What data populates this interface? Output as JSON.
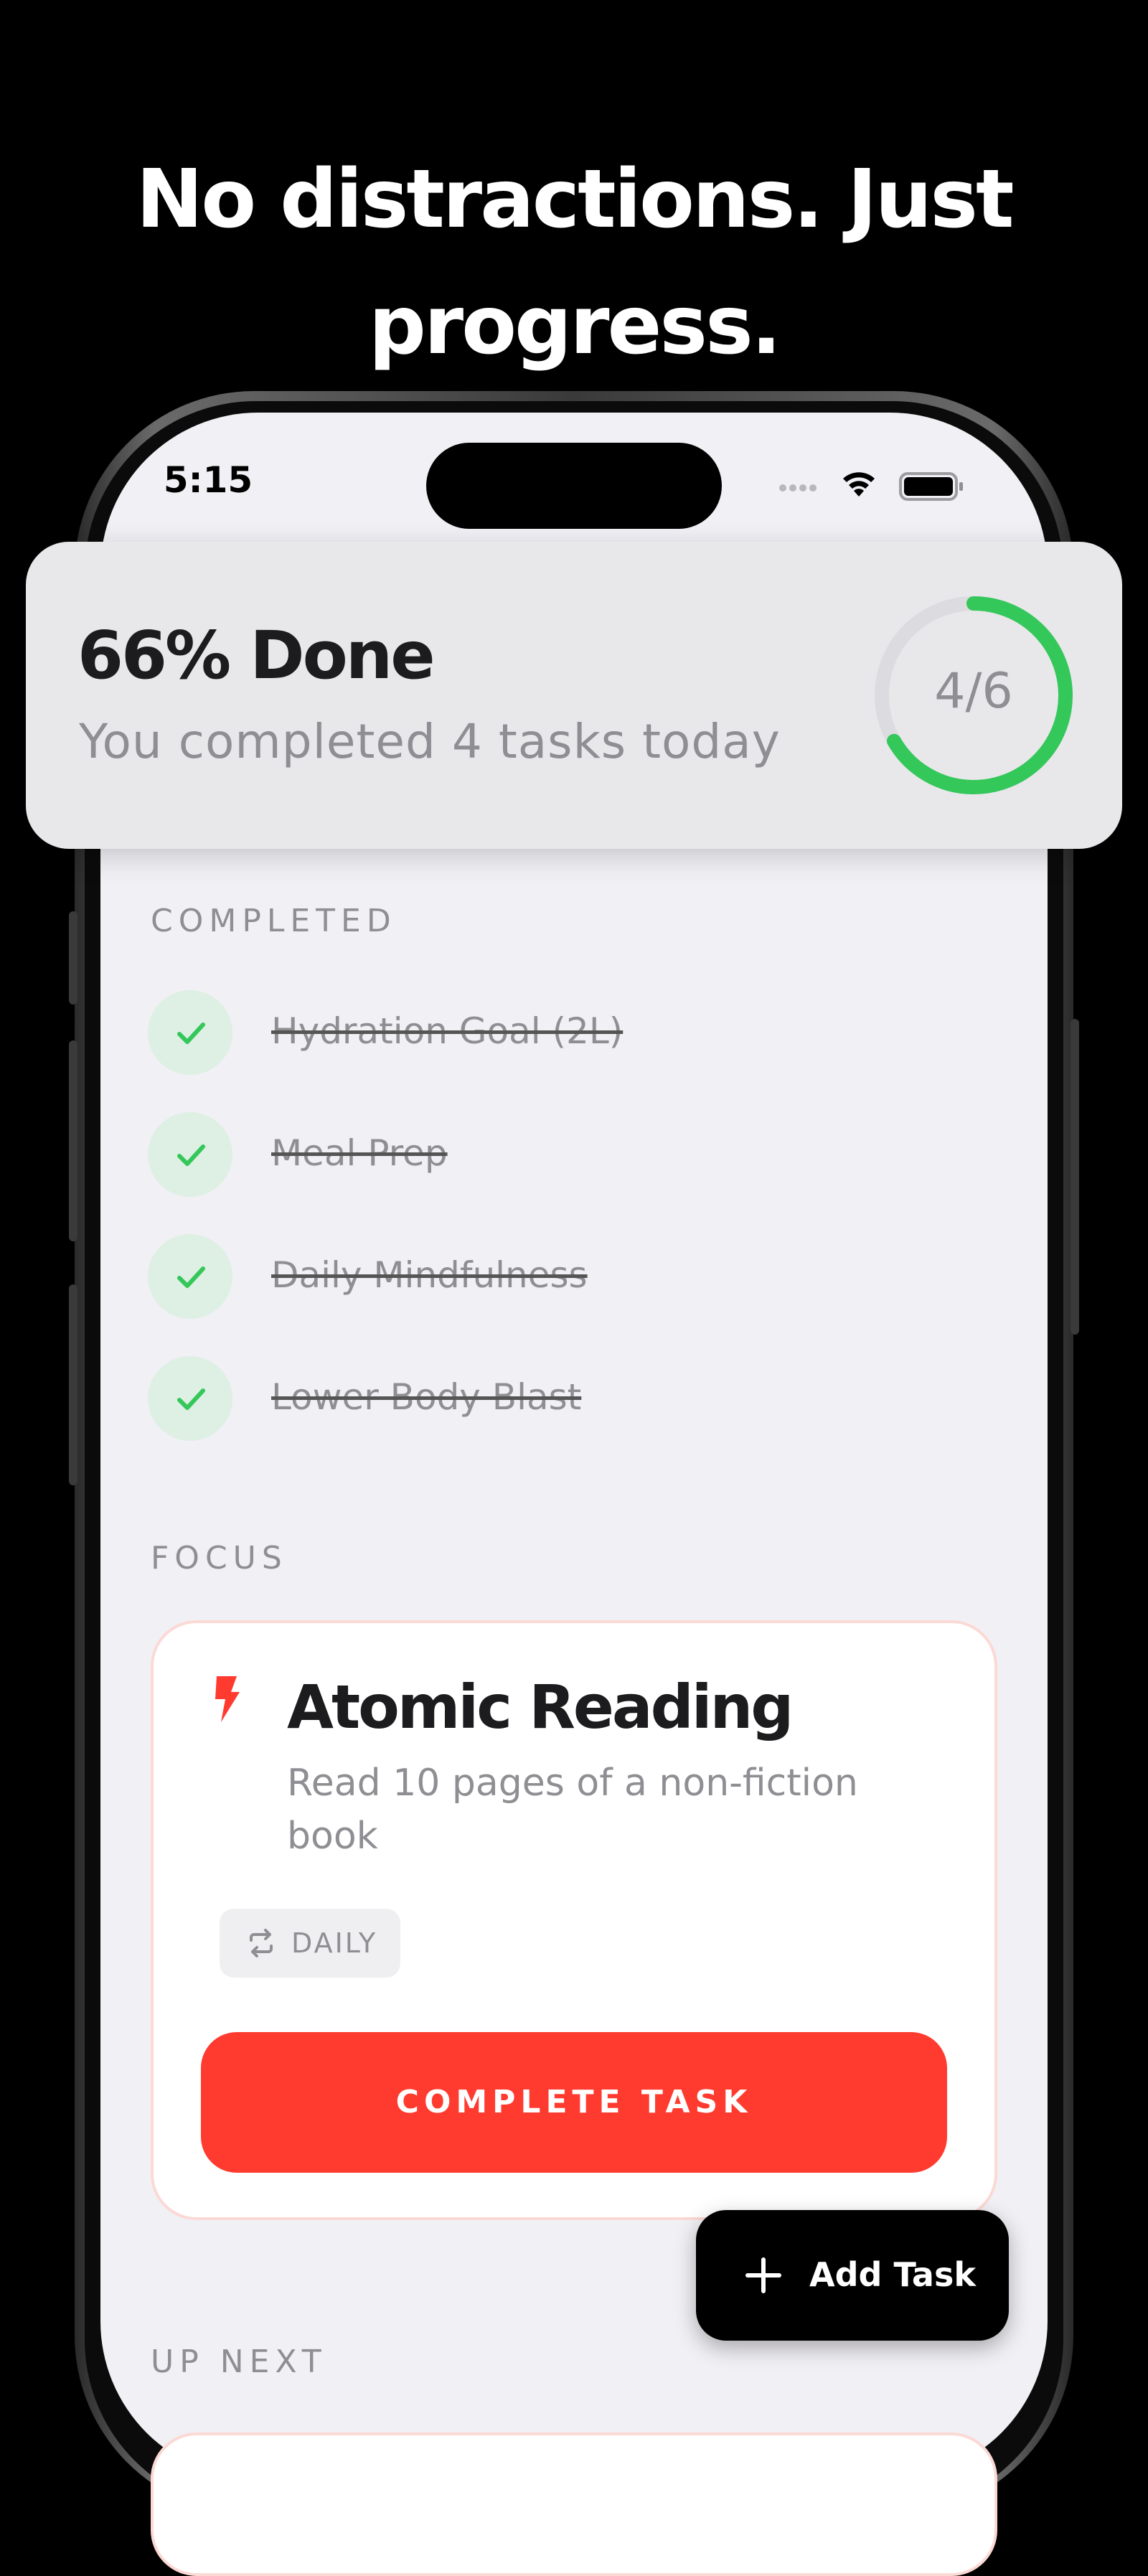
{
  "headline": {
    "line1": "No distractions. Just",
    "line2": "progress."
  },
  "status_bar": {
    "time": "5:15",
    "icons": [
      "signal-dots-icon",
      "wifi-icon",
      "battery-icon"
    ]
  },
  "summary": {
    "title": "66% Done",
    "subtitle": "You completed 4 tasks today",
    "ring_label": "4/6",
    "progress": 0.6667,
    "ring_color": "#34c759",
    "track_color": "#dcdce0"
  },
  "completed": {
    "label": "COMPLETED",
    "items": [
      {
        "label": "Hydration Goal (2L)"
      },
      {
        "label": "Meal Prep"
      },
      {
        "label": "Daily Mindfulness"
      },
      {
        "label": "Lower Body Blast"
      }
    ]
  },
  "focus": {
    "label": "FOCUS",
    "task": {
      "icon": "bolt-icon",
      "title": "Atomic Reading",
      "description": "Read 10 pages of a non-fiction book",
      "repeat_icon": "repeat-icon",
      "repeat_label": "DAILY",
      "button_label": "COMPLETE TASK"
    },
    "accent_color": "#ff3b30"
  },
  "add_task": {
    "icon": "plus-icon",
    "label": "Add Task"
  },
  "up_next": {
    "label": "UP NEXT"
  }
}
